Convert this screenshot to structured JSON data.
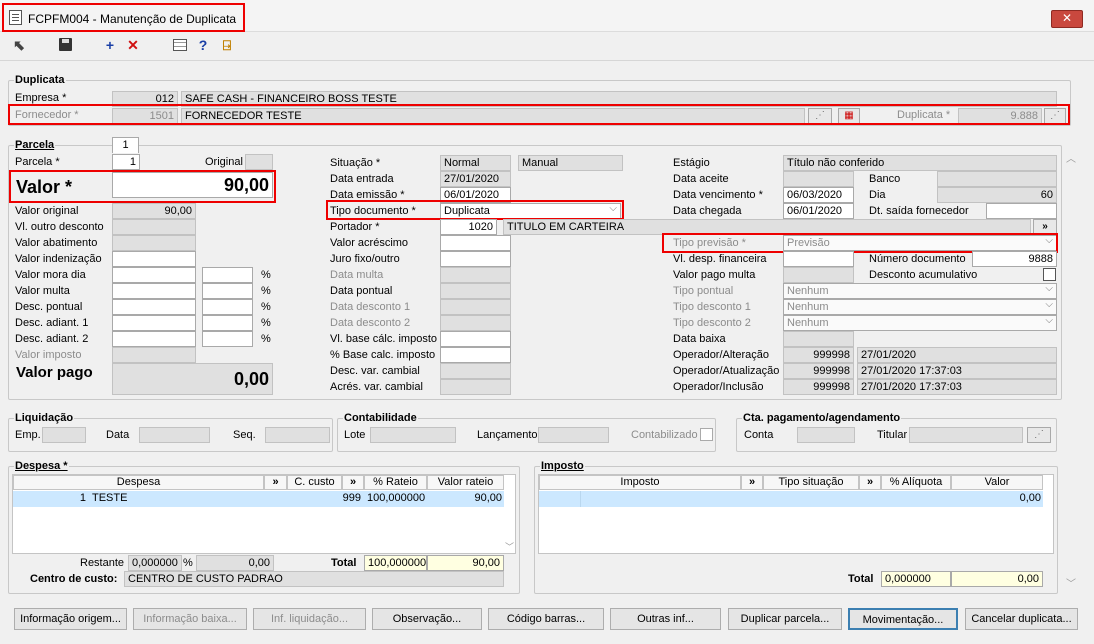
{
  "window": {
    "title": "FCPFM004 - Manutenção de Duplicata",
    "close_label": "✕"
  },
  "toolbar": {
    "add_glyph": "+",
    "delete_glyph": "✕",
    "help_glyph": "?"
  },
  "duplicata": {
    "section": "Duplicata",
    "empresa_label": "Empresa *",
    "empresa_code": "012",
    "empresa_name": "SAFE CASH - FINANCEIRO BOSS TESTE",
    "fornecedor_label": "Fornecedor *",
    "fornecedor_code": "1501",
    "fornecedor_name": "FORNECEDOR TESTE",
    "duplicata_label": "Duplicata *",
    "duplicata_value": "9.888"
  },
  "parcela": {
    "section": "Parcela",
    "tab_label": "1",
    "parcela_label": "Parcela *",
    "parcela_value": "1",
    "original_label": "Original",
    "valor_label": "Valor *",
    "valor_value": "90,00",
    "valor_original_label": "Valor original",
    "valor_original_value": "90,00",
    "vl_outro_desconto_label": "Vl. outro desconto",
    "valor_abatimento_label": "Valor abatimento",
    "valor_indenizacao_label": "Valor indenização",
    "valor_mora_dia_label": "Valor mora dia",
    "valor_multa_label": "Valor multa",
    "desc_pontual_label": "Desc. pontual",
    "desc_adiant1_label": "Desc. adiant. 1",
    "desc_adiant2_label": "Desc. adiant. 2",
    "valor_imposto_label": "Valor imposto",
    "valor_pago_label": "Valor pago",
    "valor_pago_value": "0,00",
    "percent": "%",
    "situacao_label": "Situação *",
    "situacao_value": "Normal",
    "situacao_mode": "Manual",
    "data_entrada_label": "Data entrada",
    "data_entrada_value": "27/01/2020",
    "data_emissao_label": "Data emissão *",
    "data_emissao_value": "06/01/2020",
    "tipo_documento_label": "Tipo documento *",
    "tipo_documento_value": "Duplicata",
    "portador_label": "Portador *",
    "portador_code": "1020",
    "portador_name": "TITULO EM CARTEIRA",
    "valor_acrescimo_label": "Valor acréscimo",
    "juro_label": "Juro fixo/outro",
    "data_multa_label": "Data multa",
    "data_pontual_label": "Data pontual",
    "data_desconto1_label": "Data desconto 1",
    "data_desconto2_label": "Data desconto 2",
    "vl_base_calc_label": "Vl. base cálc. imposto",
    "pct_base_calc_label": "% Base calc. imposto",
    "desc_var_cambial_label": "Desc. var. cambial",
    "acres_var_cambial_label": "Acrés. var. cambial",
    "estagio_label": "Estágio",
    "estagio_value": "Título não conferido",
    "data_aceite_label": "Data aceite",
    "banco_label": "Banco",
    "data_vencimento_label": "Data vencimento *",
    "data_vencimento_value": "06/03/2020",
    "dia_label": "Dia",
    "dia_value": "60",
    "data_chegada_label": "Data chegada",
    "data_chegada_value": "06/01/2020",
    "dt_saida_label": "Dt. saída fornecedor",
    "tipo_previsao_label": "Tipo previsão *",
    "tipo_previsao_value": "Previsão",
    "vl_desp_financeira_label": "Vl. desp. financeira",
    "numero_documento_label": "Número documento",
    "numero_documento_value": "9888",
    "valor_pago_multa_label": "Valor pago multa",
    "desconto_acumulativo_label": "Desconto acumulativo",
    "tipo_pontual_label": "Tipo pontual",
    "tipo_pontual_value": "Nenhum",
    "tipo_desconto1_label": "Tipo desconto 1",
    "tipo_desconto1_value": "Nenhum",
    "tipo_desconto2_label": "Tipo desconto 2",
    "tipo_desconto2_value": "Nenhum",
    "data_baixa_label": "Data baixa",
    "op_alteracao_label": "Operador/Alteração",
    "op_alteracao_code": "999998",
    "op_alteracao_date": "27/01/2020",
    "op_atualizacao_label": "Operador/Atualização",
    "op_atualizacao_code": "999998",
    "op_atualizacao_date": "27/01/2020 17:37:03",
    "op_inclusao_label": "Operador/Inclusão",
    "op_inclusao_code": "999998",
    "op_inclusao_date": "27/01/2020 17:37:03"
  },
  "liquidacao": {
    "section": "Liquidação",
    "emp_label": "Emp.",
    "data_label": "Data",
    "seq_label": "Seq."
  },
  "contabilidade": {
    "section": "Contabilidade",
    "lote_label": "Lote",
    "lancamento_label": "Lançamento",
    "contabilizado_label": "Contabilizado"
  },
  "cta_pagamento": {
    "section": "Cta. pagamento/agendamento",
    "conta_label": "Conta",
    "titular_label": "Titular"
  },
  "despesa": {
    "section": "Despesa *",
    "columns": [
      "Despesa",
      "C. custo",
      "% Rateio",
      "Valor rateio"
    ],
    "nav_glyph": "»",
    "row": {
      "code": "1",
      "name": "TESTE",
      "c_custo": "999",
      "rateio": "100,000000",
      "valor": "90,00"
    },
    "restante_label": "Restante",
    "restante_pct": "0,000000",
    "restante_valor": "0,00",
    "total_label": "Total",
    "total_pct": "100,000000",
    "total_valor": "90,00",
    "centro_label": "Centro de custo:",
    "centro_value": "CENTRO DE CUSTO PADRAO"
  },
  "imposto": {
    "section": "Imposto",
    "columns": [
      "Imposto",
      "Tipo situação",
      "% Alíquota",
      "Valor"
    ],
    "row_valor": "0,00",
    "total_label": "Total",
    "total_pct": "0,000000",
    "total_valor": "0,00"
  },
  "buttons": [
    "Informação origem...",
    "Informação baixa...",
    "Inf. liquidação...",
    "Observação...",
    "Código barras...",
    "Outras inf...",
    "Duplicar parcela...",
    "Movimentação...",
    "Cancelar duplicata..."
  ],
  "colors": {
    "highlight": "#e00000",
    "selected_row": "#cce8ff",
    "total_bg": "#ffffe1"
  }
}
